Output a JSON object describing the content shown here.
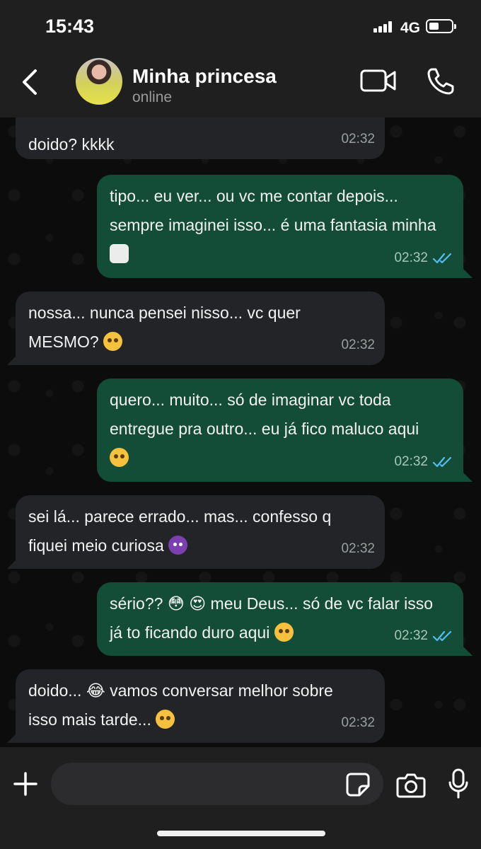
{
  "status_bar": {
    "time": "15:43",
    "network": "4G",
    "battery_level": 0.35
  },
  "header": {
    "contact_name": "Minha princesa",
    "contact_status": "online"
  },
  "messages": [
    {
      "direction": "in",
      "text": "doido? kkkk",
      "time": "02:32"
    },
    {
      "direction": "out",
      "text": "tipo... eu ver... ou vc me contar depois... sempre imaginei isso... é uma fantasia minha",
      "emoji": "steam-icon",
      "time": "02:32",
      "read": true
    },
    {
      "direction": "in",
      "text": "nossa... nunca pensei nisso... vc quer MESMO?",
      "emoji": "flushed-face-icon",
      "time": "02:32"
    },
    {
      "direction": "out",
      "text": "quero... muito... só de imaginar vc toda entregue pra outro... eu já fico maluco aqui",
      "emoji": "tired-face-icon",
      "time": "02:32",
      "read": true
    },
    {
      "direction": "in",
      "text": "sei lá... parece errado... mas... confesso q fiquei meio curiosa",
      "emoji": "devil-face-icon",
      "time": "02:32"
    },
    {
      "direction": "out",
      "text": "sério?? 😳 😍 meu Deus... só de vc falar isso já to ficando duro aqui",
      "emoji": "crying-face-icon",
      "time": "02:32",
      "read": true
    },
    {
      "direction": "in",
      "text": "doido... 😂 vamos conversar melhor sobre isso mais tarde...",
      "emoji": "relieved-face-icon",
      "time": "02:32"
    }
  ],
  "input": {
    "placeholder": ""
  },
  "colors": {
    "incoming_bubble": "#232427",
    "outgoing_bubble": "#134d38",
    "read_ticks": "#53bdeb",
    "header_bg": "#1f1f1f"
  }
}
